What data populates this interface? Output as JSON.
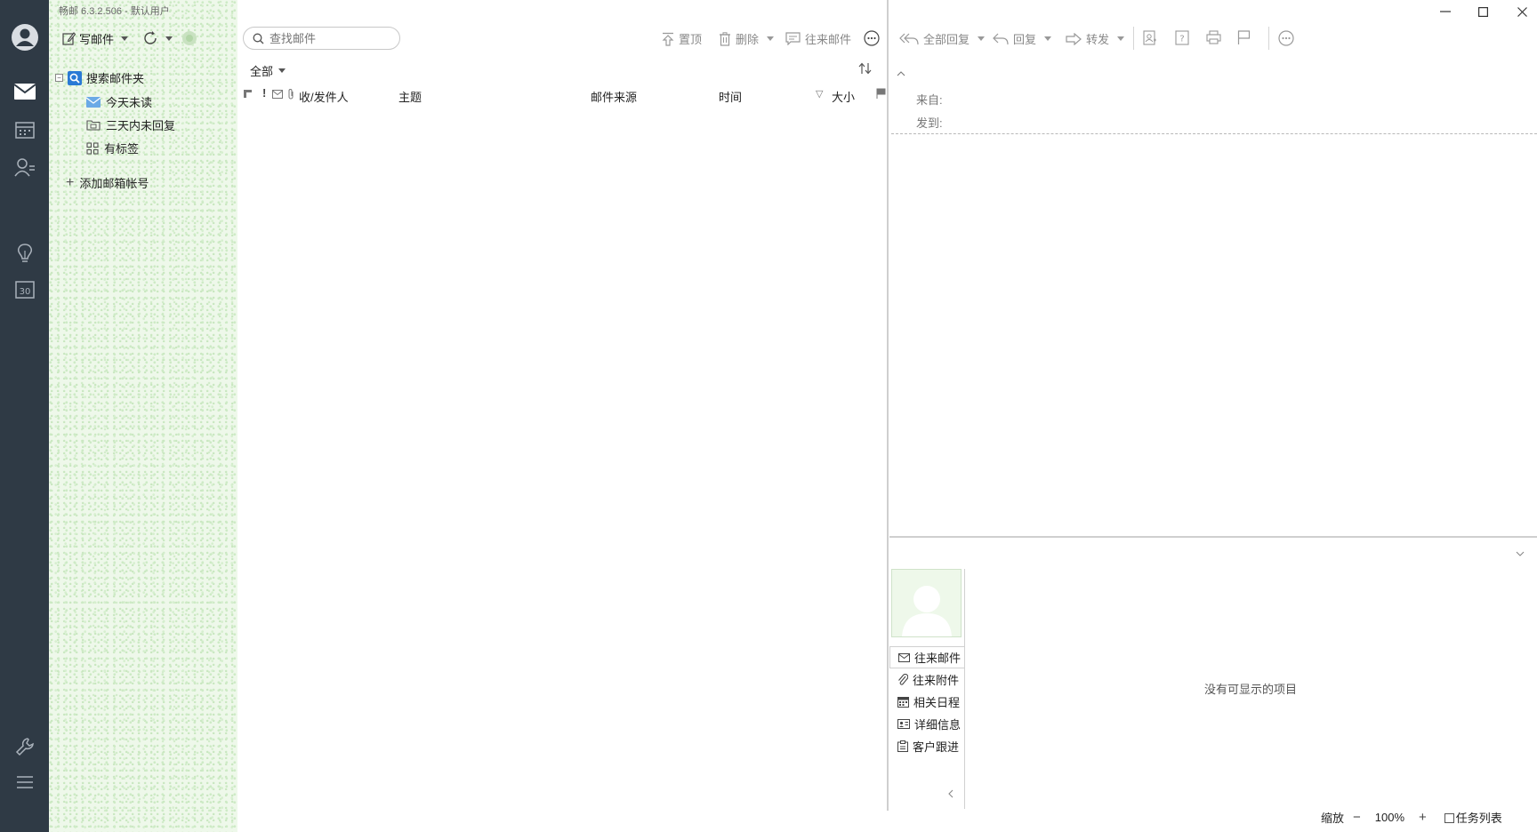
{
  "app": {
    "title": "畅邮 6.3.2.506 - 默认用户"
  },
  "folders": {
    "compose_label": "写邮件",
    "root_label": "搜索邮件夹",
    "items": [
      {
        "label": "今天未读",
        "icon": "envelope-icon"
      },
      {
        "label": "三天内未回复",
        "icon": "calendar-folder-icon"
      },
      {
        "label": "有标签",
        "icon": "grid-tag-icon"
      }
    ],
    "add_account_label": "添加邮箱帐号"
  },
  "list": {
    "search_placeholder": "查找邮件",
    "toolbar": {
      "pin_label": "置顶",
      "delete_label": "删除",
      "related_label": "往来邮件"
    },
    "filter_label": "全部",
    "columns": {
      "sender": "收/发件人",
      "subject": "主题",
      "source": "邮件来源",
      "time": "时间",
      "size": "大小"
    }
  },
  "reading": {
    "toolbar": {
      "reply_all_label": "全部回复",
      "reply_label": "回复",
      "forward_label": "转发"
    },
    "from_label": "来自:",
    "to_label": "发到:",
    "side_tabs": [
      {
        "label": "往来邮件",
        "icon": "mail-small-icon"
      },
      {
        "label": "往来附件",
        "icon": "paperclip-icon"
      },
      {
        "label": "相关日程",
        "icon": "calendar-small-icon"
      },
      {
        "label": "详细信息",
        "icon": "id-card-icon"
      },
      {
        "label": "客户跟进",
        "icon": "clipboard-icon"
      }
    ],
    "empty_message": "没有可显示的项目"
  },
  "status": {
    "zoom_label": "缩放",
    "zoom_value": "100%",
    "tasklist_label": "任务列表"
  },
  "colors": {
    "rail": "#2f3a45",
    "folder_bg": "#eef8ea",
    "accent": "#2a7ad5"
  }
}
